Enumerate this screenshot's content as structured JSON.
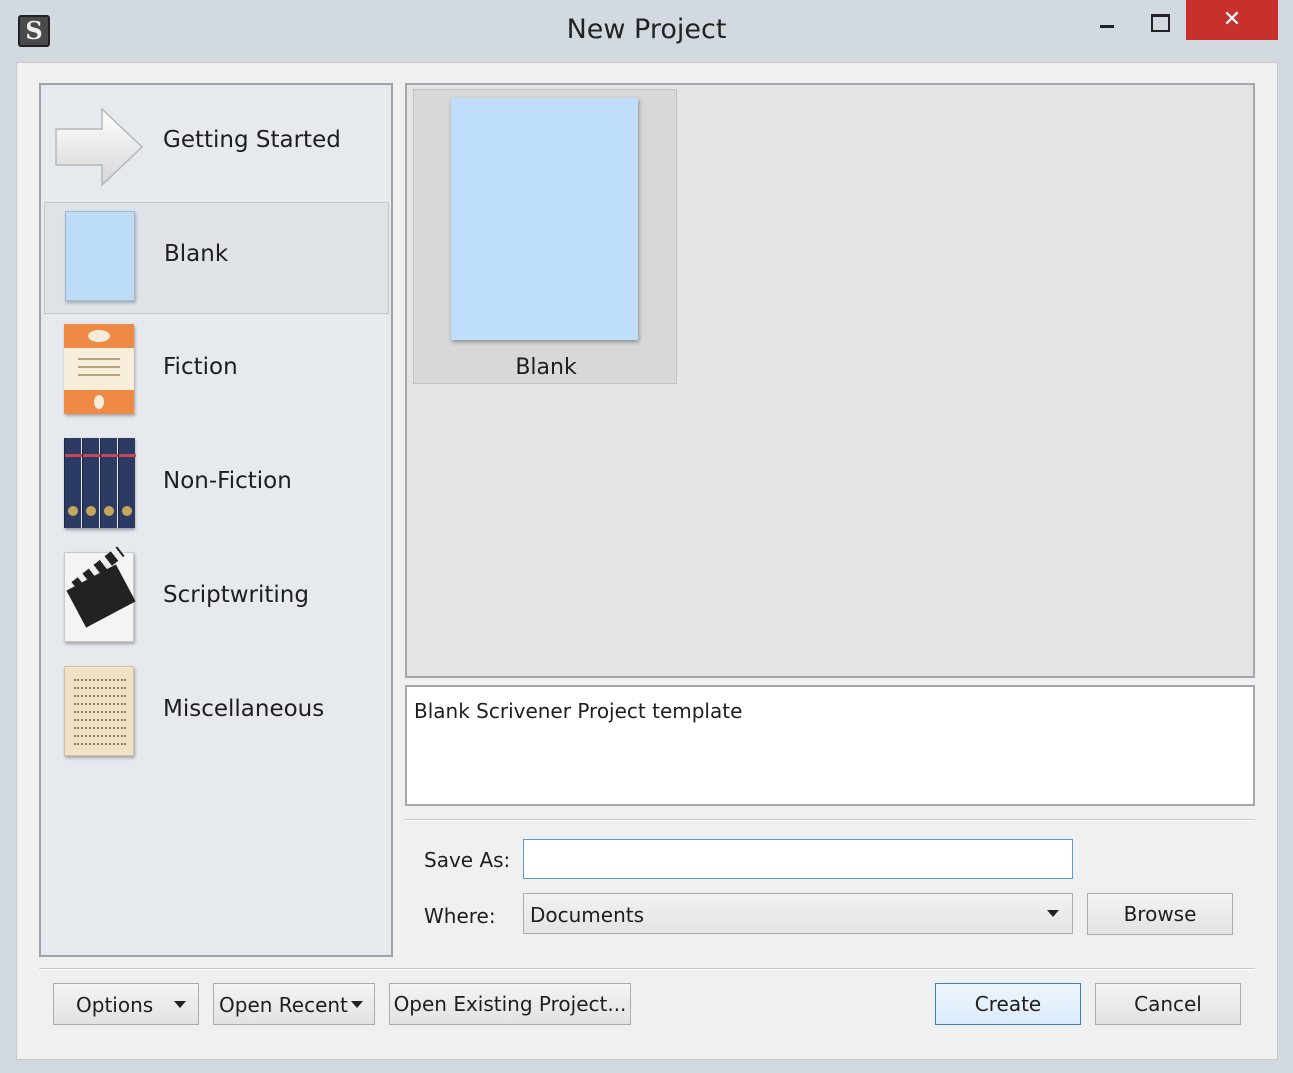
{
  "window": {
    "title": "New Project",
    "close_glyph": "✕",
    "app_icon_letter": "S"
  },
  "sidebar": {
    "items": [
      {
        "label": "Getting Started",
        "icon": "arrow-icon"
      },
      {
        "label": "Blank",
        "icon": "blank-page-icon",
        "selected": true
      },
      {
        "label": "Fiction",
        "icon": "fiction-book-icon"
      },
      {
        "label": "Non-Fiction",
        "icon": "books-icon"
      },
      {
        "label": "Scriptwriting",
        "icon": "clapperboard-icon"
      },
      {
        "label": "Miscellaneous",
        "icon": "parchment-icon"
      }
    ]
  },
  "gallery": {
    "templates": [
      {
        "label": "Blank",
        "selected": true
      }
    ]
  },
  "description": {
    "text": "Blank Scrivener Project template"
  },
  "form": {
    "save_as_label": "Save As:",
    "save_as_value": "",
    "where_label": "Where:",
    "where_value": "Documents",
    "browse_label": "Browse"
  },
  "footer": {
    "options_label": "Options",
    "open_recent_label": "Open Recent",
    "open_existing_label": "Open Existing Project...",
    "create_label": "Create",
    "cancel_label": "Cancel"
  },
  "colors": {
    "accent": "#5b9bd5",
    "close_button": "#c7302b",
    "blank_page": "#bfdefb"
  }
}
